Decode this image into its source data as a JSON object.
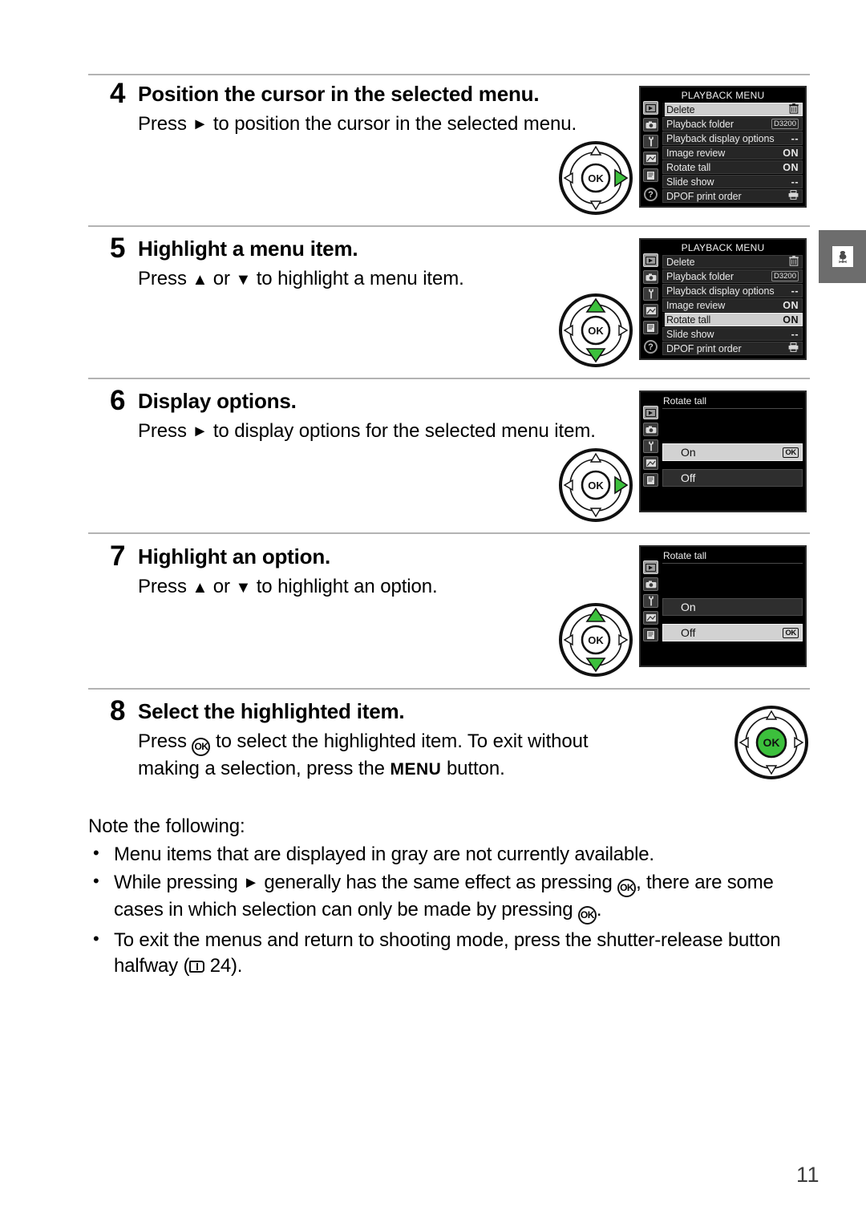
{
  "page": {
    "number": "11"
  },
  "steps": [
    {
      "num": "4",
      "title": "Position the cursor in the selected menu.",
      "desc_before": "Press",
      "desc_after": "to position the cursor in the selected menu.",
      "dial": "right-arrow-highlighted"
    },
    {
      "num": "5",
      "title": "Highlight a menu item.",
      "desc_before": "Press",
      "desc_mid": "or",
      "desc_after": "to highlight a menu item.",
      "dial": "up-down-arrows-highlighted"
    },
    {
      "num": "6",
      "title": "Display options.",
      "desc_before": "Press",
      "desc_after": "to display options for the selected menu item.",
      "dial": "right-arrow-highlighted"
    },
    {
      "num": "7",
      "title": "Highlight an option.",
      "desc_before": "Press",
      "desc_mid": "or",
      "desc_after": "to highlight an option.",
      "dial": "up-down-arrows-highlighted"
    },
    {
      "num": "8",
      "title": "Select the highlighted item.",
      "desc_part1": "Press",
      "desc_part2": "to select the highlighted item.  To exit without making a selection, press the",
      "desc_menu": "MENU",
      "desc_part3": "button.",
      "dial": "ok-button-highlighted"
    }
  ],
  "lcd_playback_menu": {
    "title": "PLAYBACK MENU",
    "sidebar_icons": [
      "playback-icon",
      "shooting-camera-icon",
      "setup-wrench-icon",
      "retouch-icon",
      "recent-settings-icon"
    ],
    "help_label": "?",
    "rows": [
      {
        "label": "Delete",
        "value": "trash-icon",
        "value_kind": "icon"
      },
      {
        "label": "Playback folder",
        "value": "D3200",
        "value_kind": "small"
      },
      {
        "label": "Playback display options",
        "value": "--",
        "value_kind": "dash"
      },
      {
        "label": "Image review",
        "value": "ON",
        "value_kind": "text"
      },
      {
        "label": "Rotate tall",
        "value": "ON",
        "value_kind": "text"
      },
      {
        "label": "Slide show",
        "value": "--",
        "value_kind": "dash"
      },
      {
        "label": "DPOF print order",
        "value": "printer-icon",
        "value_kind": "icon"
      }
    ],
    "step4_highlight": "Delete",
    "step5_highlight": "Rotate tall"
  },
  "lcd_rotate_tall": {
    "title": "Rotate tall",
    "options": [
      {
        "label": "On",
        "badge": "OK"
      },
      {
        "label": "Off",
        "badge": "OK"
      }
    ],
    "step6_highlight": "On",
    "step7_highlight": "Off"
  },
  "side_tab": {
    "icon": "rooster-weathervane-icon"
  },
  "notes": {
    "lead": "Note the following:",
    "bullet": "•",
    "items": [
      {
        "text": "Menu items that are displayed in gray are not currently available."
      },
      {
        "part1": "While pressing",
        "part2": "generally has the same effect as pressing",
        "part3": ", there are some cases in which selection can only be made by pressing",
        "part4": "."
      },
      {
        "part1": "To exit the menus and return to shooting mode, press the shutter-release button halfway (",
        "page_ref": "24",
        "part2": ")."
      }
    ]
  },
  "colors": {
    "accent_green": "#3cc03c",
    "rule_gray": "#b3b3b3",
    "lcd_black": "#000000",
    "lcd_row": "#262626",
    "lcd_highlight": "#cfcfcf",
    "tab_gray": "#6d6d6d"
  }
}
